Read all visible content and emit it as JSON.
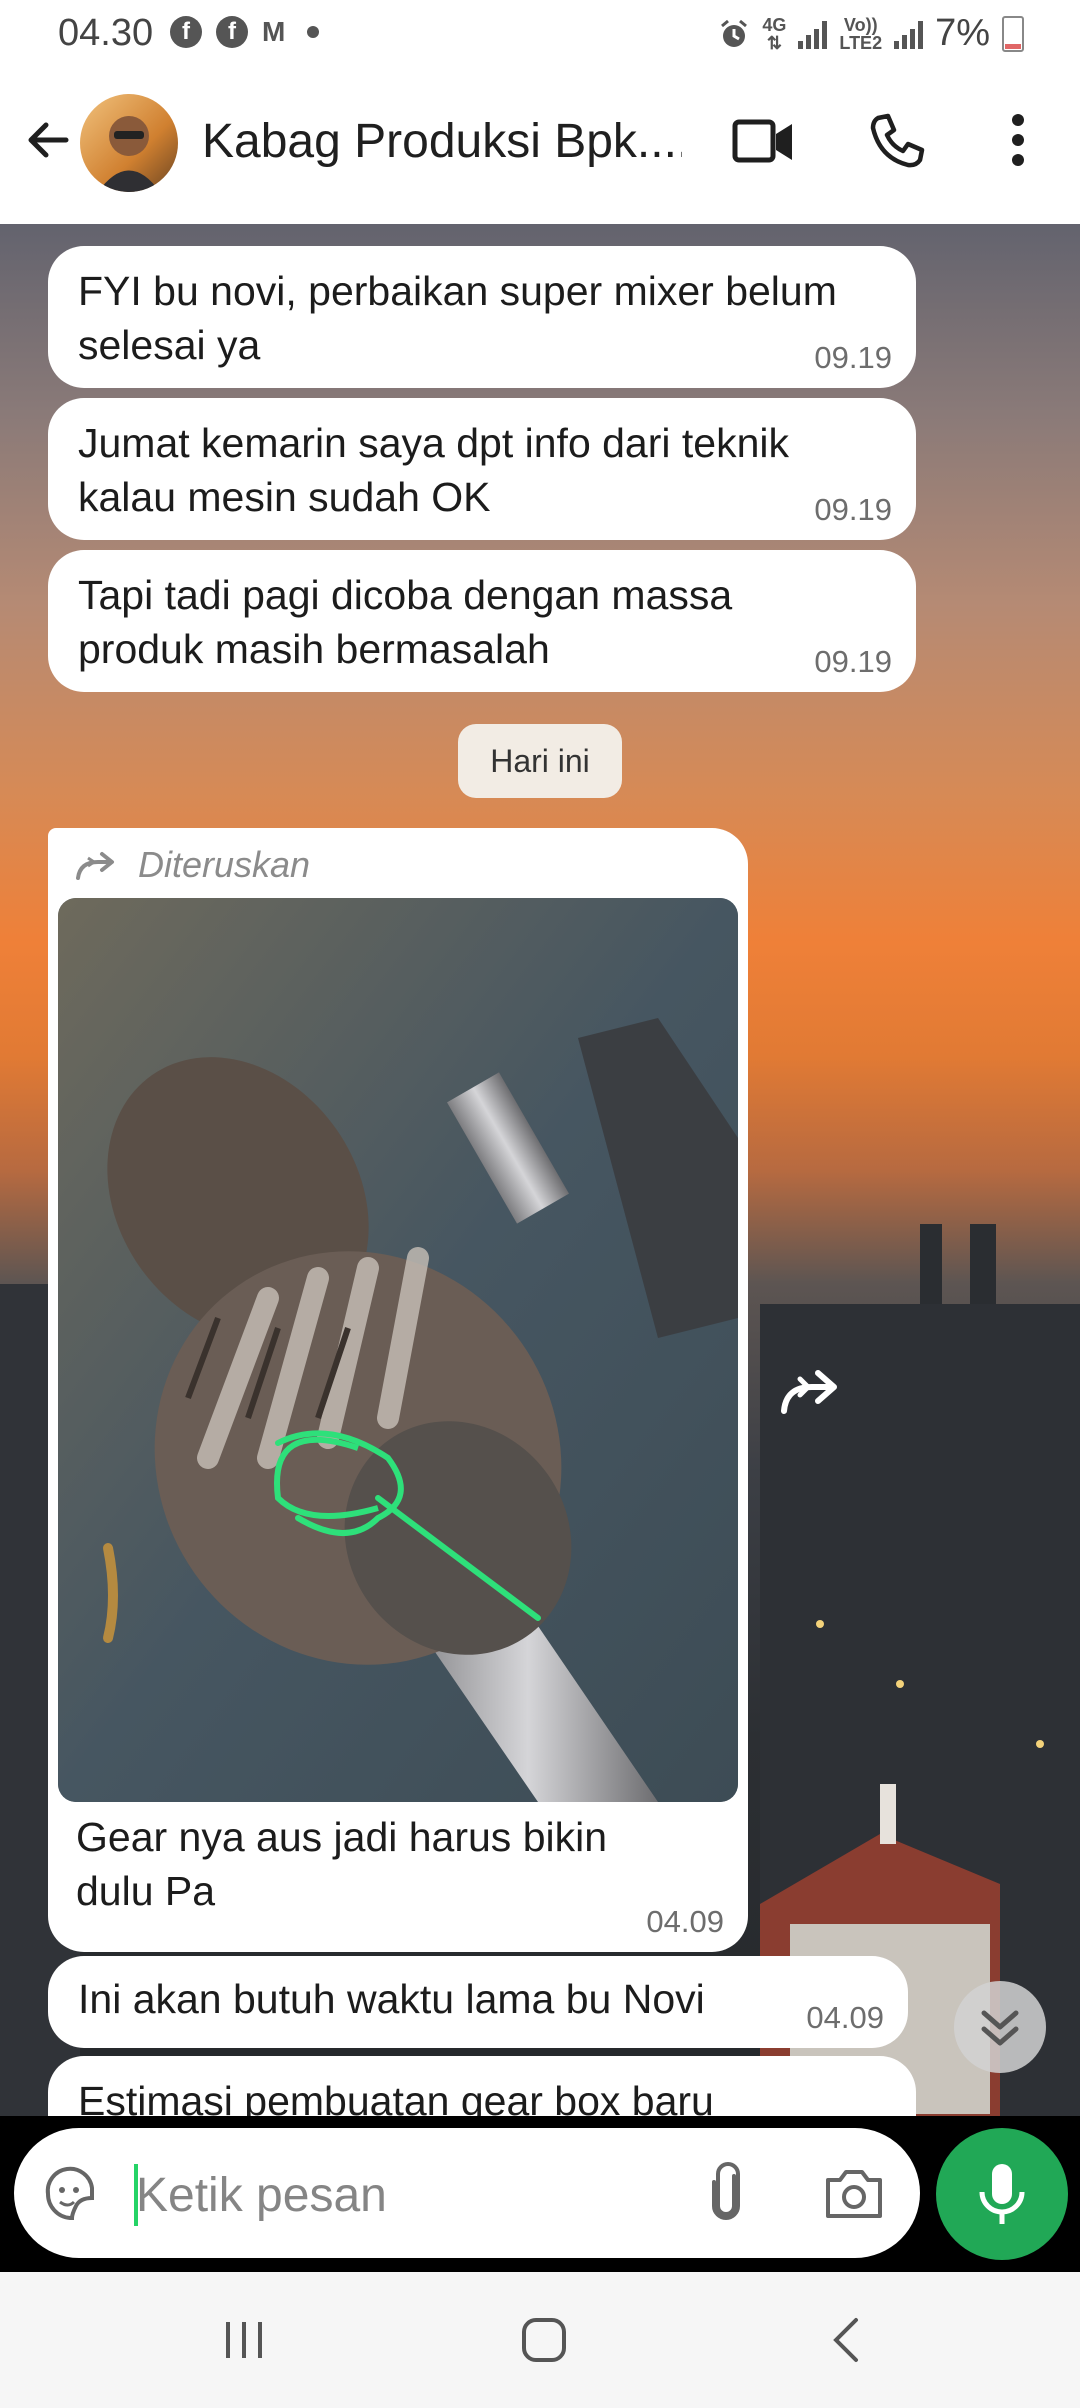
{
  "status_bar": {
    "time": "04.30",
    "notif_fb": "f",
    "notif_mail": "M",
    "net_top": "4G",
    "net_lte_top": "Vo))",
    "net_lte_bottom": "LTE2",
    "battery": "7%"
  },
  "header": {
    "contact_name": "Kabag Produksi Bpk....",
    "icons": [
      "back-arrow-icon",
      "video-call-icon",
      "phone-icon",
      "more-vert-icon"
    ]
  },
  "messages": [
    {
      "text": "FYI bu novi, perbaikan super mixer belum selesai ya",
      "time": "09.19"
    },
    {
      "text": "Jumat kemarin saya dpt info dari teknik kalau mesin sudah OK",
      "time": "09.19"
    },
    {
      "text": "Tapi tadi pagi dicoba dengan massa produk masih bermasalah",
      "time": "09.19"
    }
  ],
  "day_divider": "Hari ini",
  "forwarded": {
    "label": "Diteruskan",
    "caption": "Gear nya aus jadi harus bikin dulu Pa",
    "time": "04.09"
  },
  "message_after": {
    "text": "Ini akan butuh waktu lama bu Novi",
    "time": "04.09"
  },
  "message_partial": {
    "text": "Estimasi pembuatan gear box baru"
  },
  "input": {
    "placeholder": "Ketik pesan"
  },
  "colors": {
    "accent": "#21a856",
    "caret": "#25d366",
    "annotation": "#2ee07a"
  }
}
